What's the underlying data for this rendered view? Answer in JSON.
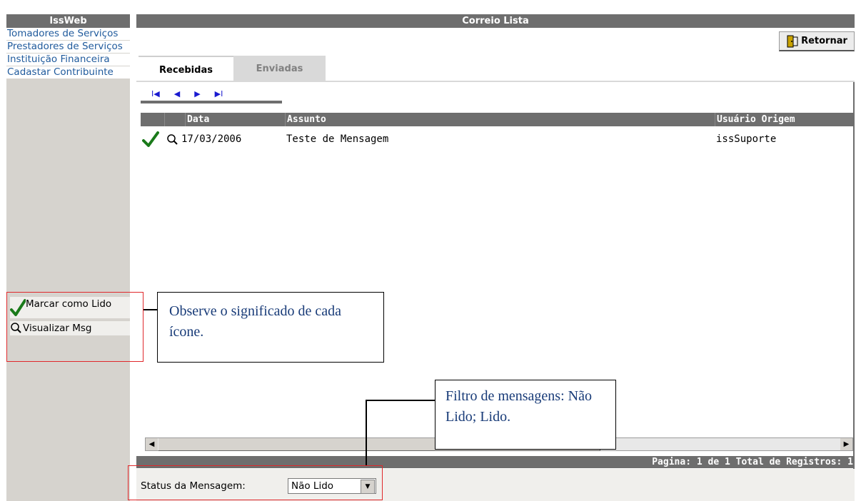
{
  "sidebar": {
    "title": "IssWeb",
    "menu": [
      {
        "label": "Tomadores de Serviços"
      },
      {
        "label": "Prestadores de Serviços"
      },
      {
        "label": "Instituição Financeira"
      },
      {
        "label": "Cadastar Contribuinte"
      }
    ],
    "legend": [
      {
        "icon": "check-icon",
        "label": "Marcar como Lido"
      },
      {
        "icon": "magnifier-icon",
        "label": "Visualizar Msg"
      }
    ]
  },
  "main": {
    "title": "Correio Lista",
    "return_button": "Retornar",
    "tabs": [
      {
        "label": "Recebidas",
        "active": true
      },
      {
        "label": "Enviadas",
        "active": false
      }
    ],
    "pager": {
      "first": "I◀",
      "prev": "◀",
      "next": "▶",
      "last": "▶I"
    },
    "columns": [
      "Data",
      "Assunto",
      "Usuário Origem"
    ],
    "rows": [
      {
        "date": "17/03/2006",
        "subject": "Teste de Mensagem",
        "origin": "issSuporte"
      }
    ],
    "footer": "Pagina: 1 de 1 Total de Registros: 1",
    "status_label": "Status da Mensagem:",
    "status_value": "Não Lido"
  },
  "annotations": {
    "icons_note": "Observe o significado de cada ícone.",
    "filter_note": "Filtro de mensagens: Não Lido; Lido."
  },
  "colors": {
    "header_bg": "#6e6e6e",
    "sidebar_bg": "#d6d3ce",
    "link": "#1f5a9c",
    "check": "#1a7a1a",
    "highlight": "#e0282b",
    "callout_text": "#183b78"
  }
}
